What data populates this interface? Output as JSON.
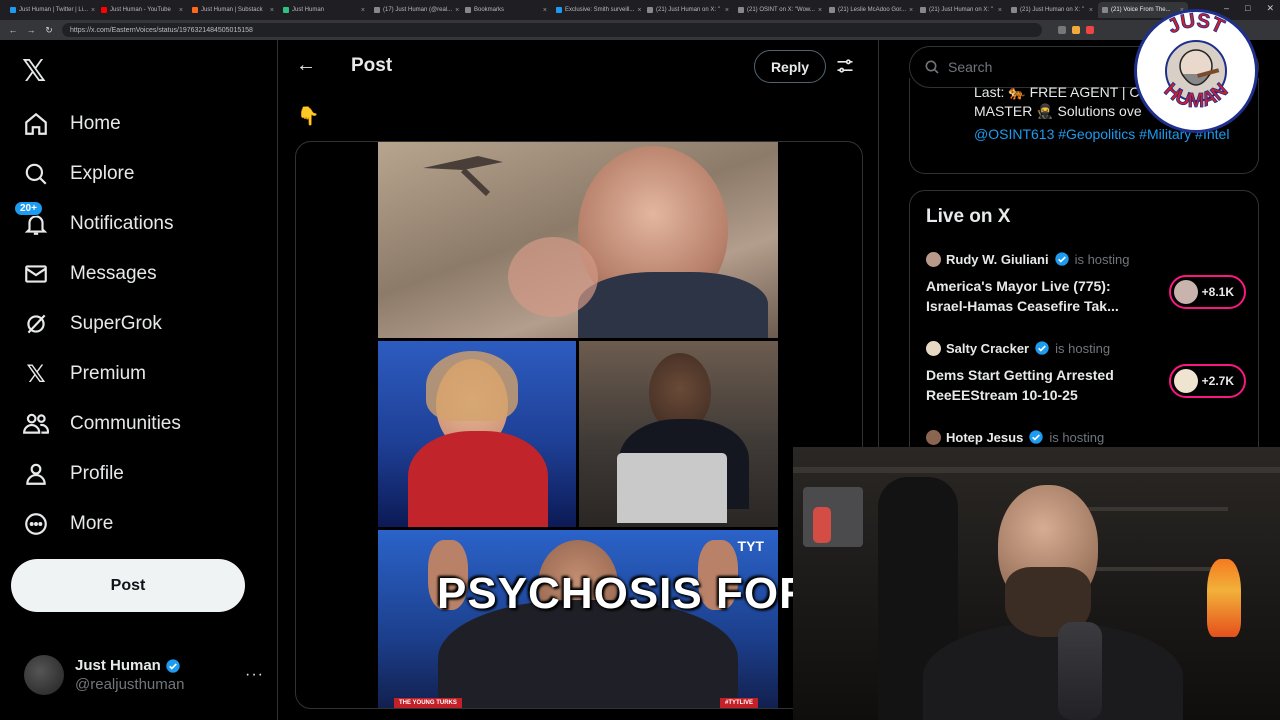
{
  "browser": {
    "tabs": [
      {
        "label": "Just Human | Twitter | Li...",
        "color": "#1d9bf0"
      },
      {
        "label": "Just Human - YouTube",
        "color": "#ff0000"
      },
      {
        "label": "Just Human | Substack",
        "color": "#ff6719"
      },
      {
        "label": "Just Human",
        "color": "#2ec27e"
      },
      {
        "label": "(17) Just Human (@real...",
        "color": "#888888"
      },
      {
        "label": "Bookmarks",
        "color": "#888888"
      },
      {
        "label": "Exclusive: Smith surveill...",
        "color": "#1d9bf0"
      },
      {
        "label": "(21) Just Human on X: \"",
        "color": "#888888"
      },
      {
        "label": "(21) OSINT on X: \"Wow...",
        "color": "#888888"
      },
      {
        "label": "(21) Leslie McAdoo Gor...",
        "color": "#888888"
      },
      {
        "label": "(21) Just Human on X: \"",
        "color": "#888888"
      },
      {
        "label": "(21) Just Human on X: \"",
        "color": "#888888"
      },
      {
        "label": "(21) Voice From The...",
        "color": "#888888"
      }
    ],
    "url": "https://x.com/EasternVoices/status/1976321484505015158"
  },
  "nav": {
    "items": [
      {
        "label": "Home",
        "icon": "home-icon"
      },
      {
        "label": "Explore",
        "icon": "search-icon"
      },
      {
        "label": "Notifications",
        "icon": "bell-icon",
        "badge": "20+"
      },
      {
        "label": "Messages",
        "icon": "envelope-icon"
      },
      {
        "label": "SuperGrok",
        "icon": "grok-icon"
      },
      {
        "label": "Premium",
        "icon": "x-logo-icon"
      },
      {
        "label": "Communities",
        "icon": "people-icon"
      },
      {
        "label": "Profile",
        "icon": "person-icon"
      },
      {
        "label": "More",
        "icon": "more-circle-icon"
      }
    ],
    "post_button": "Post",
    "account": {
      "name": "Just Human",
      "handle": "@realjusthuman",
      "more": "···"
    }
  },
  "post": {
    "title": "Post",
    "reply_button": "Reply",
    "emoji": "👇",
    "media_channel": "TYT",
    "media_lower_left": "THE YOUNG TURKS",
    "media_lower_right": "#TYTLIVE"
  },
  "caption": "PSYCHOSIS  FOR",
  "sidebar": {
    "search_placeholder": "Search",
    "trend_line1": "Last: 🐅 FREE AGENT | C",
    "trend_line1b": "MASTER 🥷 Solutions ove",
    "trend_tags": "@OSINT613 #Geopolitics #Military #Intel",
    "live_title": "Live on X",
    "live": [
      {
        "host": "Rudy W. Giuliani",
        "status": "is hosting",
        "topic": "America's Mayor Live (775): Israel-Hamas Ceasefire Tak...",
        "listeners": "+8.1K"
      },
      {
        "host": "Salty Cracker",
        "status": "is hosting",
        "topic": "Dems Start Getting Arrested ReeEEStream 10-10-25",
        "listeners": "+2.7K"
      },
      {
        "host": "Hotep Jesus",
        "status": "is hosting",
        "topic": "",
        "listeners": ""
      }
    ]
  },
  "logo": {
    "text_top": "JUST",
    "text_bottom": "HUMAN"
  },
  "colors": {
    "accent": "#1d9bf0",
    "live_ring": "#f91880",
    "background": "#000000",
    "text": "#e7e9ea",
    "muted": "#71767b"
  }
}
